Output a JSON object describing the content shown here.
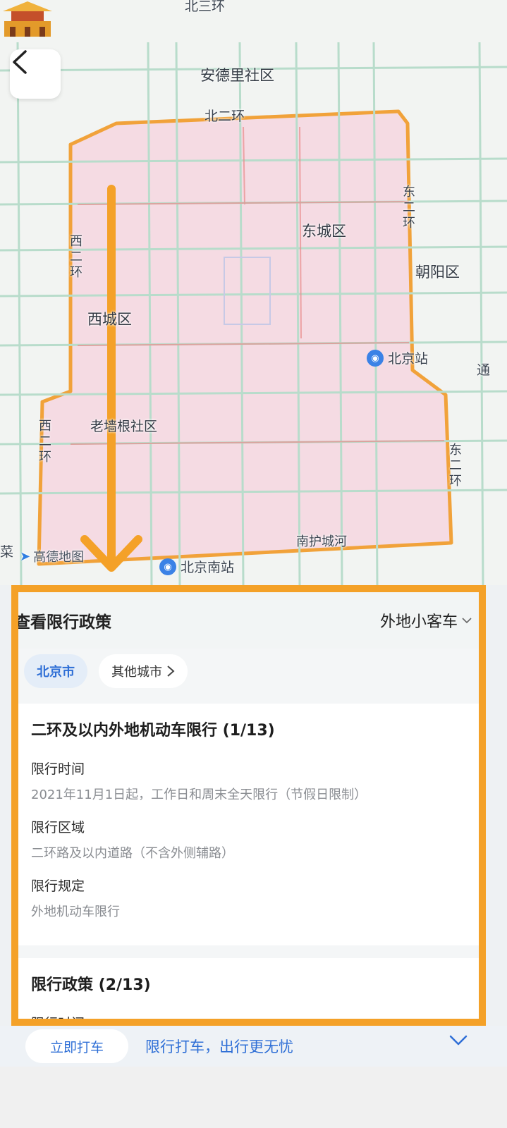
{
  "map": {
    "road_labels": {
      "north_ring_top": "北三环",
      "north_ring": "北二环",
      "east_ring": "东二环",
      "west_ring": "西二环",
      "west_ring_south": "西二环",
      "east_ring_south": "东二环",
      "moat": "南护城河"
    },
    "districts": {
      "andeli": "安德里社区",
      "dongcheng": "东城区",
      "chaoyang": "朝阳区",
      "xicheng": "西城区",
      "laoqiang": "老墙根社区",
      "tong": "通"
    },
    "stations": {
      "beijing": "北京站",
      "beijing_south": "北京南站"
    },
    "watermark": "高德地图",
    "edge_label": "菜",
    "colors": {
      "restricted_fill": "#f5dbe3",
      "ring_road": "#f1a23a",
      "arrow": "#f4a128"
    }
  },
  "panel": {
    "title": "查看限行政策",
    "vehicle_type": "外地小客车",
    "city_active": "北京市",
    "city_other": "其他城市",
    "policies": [
      {
        "title": "二环及以内外地机动车限行 (1/13)",
        "fields": [
          {
            "label": "限行时间",
            "value": "2021年11月1日起，工作日和周末全天限行（节假日限制）"
          },
          {
            "label": "限行区域",
            "value": "二环路及以内道路（不含外侧辅路）"
          },
          {
            "label": "限行规定",
            "value": "外地机动车限行"
          }
        ]
      },
      {
        "title": "限行政策 (2/13)",
        "fields": [
          {
            "label": "限行时间",
            "value": ""
          }
        ]
      }
    ]
  },
  "bottom_bar": {
    "taxi_button": "立即打车",
    "slogan": "限行打车，出行更无忧"
  }
}
